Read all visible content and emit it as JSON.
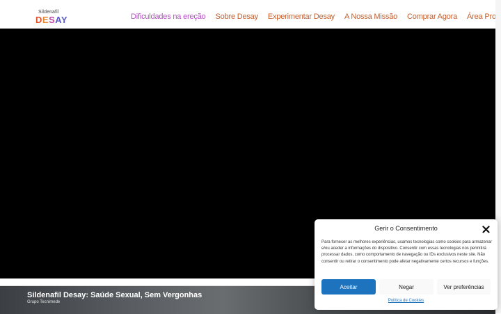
{
  "logo": {
    "top": "Sildenafil",
    "main_1": "D",
    "main_2": "E",
    "main_3": "S",
    "main_4": "AY"
  },
  "nav": [
    {
      "label": "Dificuldades na ereção"
    },
    {
      "label": "Sobre Desay"
    },
    {
      "label": "Experimentar Desay"
    },
    {
      "label": "A Nossa Missão"
    },
    {
      "label": "Comprar Agora"
    },
    {
      "label": "Área Profissional"
    }
  ],
  "video_preview": {
    "title": "Sildenafil Desay: Saúde Sexual, Sem Vergonhas",
    "channel": "Grupo Tecnimede"
  },
  "consent": {
    "title": "Gerir o Consentimento",
    "text": "Para fornecer as melhores experiências, usamos tecnologias como cookies para armazenar e/ou aceder a informações do dispositivo. Consentir com essas tecnologias nos permitirá processar dados, como comportamento de navegação ou IDs exclusivos neste site. Não consentir ou retirar o consentimento pode afetar negativamente certos recursos e funções.",
    "accept_label": "Aceitar",
    "deny_label": "Negar",
    "prefs_label": "Ver preferências",
    "policy_link": "Política de Cookies"
  },
  "colors": {
    "accent": "#1e73be",
    "nav_text": "#c25e2c",
    "nav_active": "#b64ac8"
  }
}
